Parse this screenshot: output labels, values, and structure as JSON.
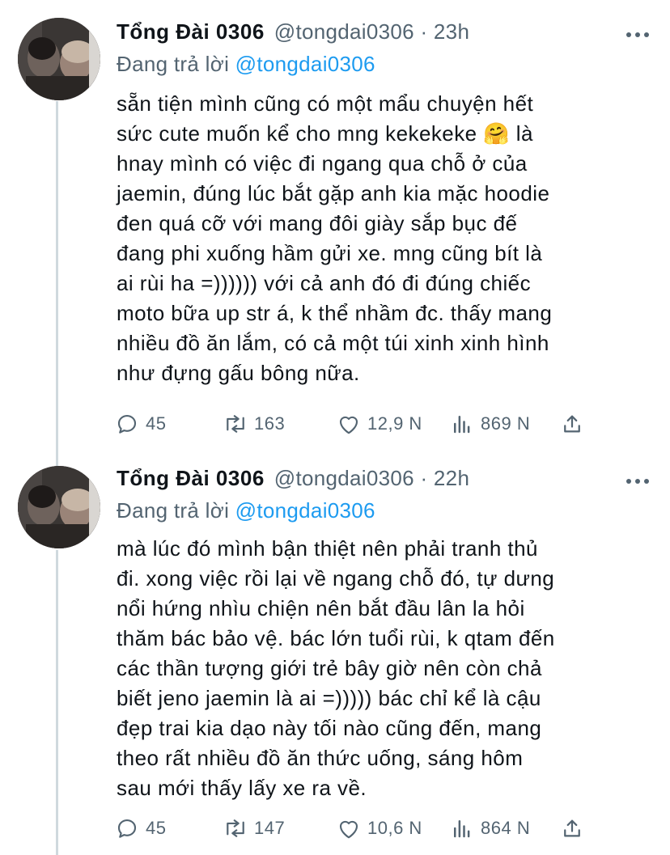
{
  "tweets": [
    {
      "author_name": "Tổng Đài 0306",
      "handle_time": "@tongdai0306 · 23h",
      "reply_prefix": "Đang trả lời ",
      "reply_mention": "@tongdai0306",
      "text": "sẵn tiện mình cũng có một mẩu chuyện hết\nsức cute muốn kể cho mng kekekeke 🤗  là\nhnay mình có việc đi ngang qua chỗ ở của\njaemin, đúng lúc bắt gặp anh kia mặc hoodie\nđen quá cỡ với mang đôi giày sắp bục đế\nđang phi xuống hầm gửi xe. mng cũng bít là\nai rùi ha =)))))) với cả anh đó đi đúng chiếc\nmoto bữa up str á, k thể nhầm đc. thấy mang\nnhiều đồ ăn lắm, có cả một túi xinh xinh hình\nnhư đựng gấu bông nữa.",
      "replies": "45",
      "retweets": "163",
      "likes": "12,9 N",
      "views": "869 N"
    },
    {
      "author_name": "Tổng Đài 0306",
      "handle_time": "@tongdai0306 · 22h",
      "reply_prefix": "Đang trả lời ",
      "reply_mention": "@tongdai0306",
      "text": "mà lúc đó mình bận thiệt nên phải tranh thủ\nđi. xong việc rồi lại về ngang chỗ đó, tự dưng\nnổi hứng nhìu chiện nên bắt đầu lân la hỏi\nthăm bác bảo vệ. bác lớn tuổi rùi, k qtam đến\ncác thần tượng giới trẻ bây giờ nên còn chả\nbiết jeno jaemin là ai =))))) bác chỉ kể là cậu\nđẹp trai kia dạo này tối nào cũng đến, mang\ntheo rất nhiều đồ ăn thức uống, sáng hôm\nsau mới thấy lấy xe ra về.",
      "replies": "45",
      "retweets": "147",
      "likes": "10,6 N",
      "views": "864 N"
    }
  ],
  "colors": {
    "accent": "#1d9bf0",
    "secondary_text": "#536471",
    "thread_line": "#cfd9de"
  },
  "icons": [
    "more-icon",
    "reply-icon",
    "retweet-icon",
    "like-icon",
    "views-icon",
    "share-icon"
  ]
}
